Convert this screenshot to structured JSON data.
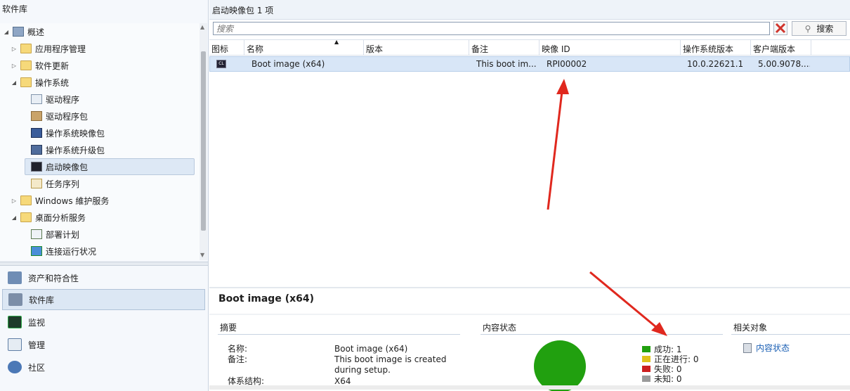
{
  "left_pane": {
    "title": "软件库",
    "tree": [
      {
        "label": "概述"
      },
      {
        "label": "应用程序管理"
      },
      {
        "label": "软件更新"
      },
      {
        "label": "操作系统"
      },
      {
        "label": "驱动程序"
      },
      {
        "label": "驱动程序包"
      },
      {
        "label": "操作系统映像包"
      },
      {
        "label": "操作系统升级包"
      },
      {
        "label": "启动映像包"
      },
      {
        "label": "任务序列"
      },
      {
        "label": "Windows 維护服务"
      },
      {
        "label": "桌面分析服务"
      },
      {
        "label": "部署计划"
      },
      {
        "label": "连接运行状况"
      }
    ],
    "workspaces": [
      {
        "label": "资产和符合性"
      },
      {
        "label": "软件库"
      },
      {
        "label": "监视"
      },
      {
        "label": "管理"
      },
      {
        "label": "社区"
      }
    ]
  },
  "content": {
    "header": "启动映像包 1 项",
    "search_placeholder": "搜索",
    "search_button": "搜索",
    "columns": [
      "图标",
      "名称",
      "版本",
      "备注",
      "映像 ID",
      "操作系统版本",
      "客户端版本"
    ],
    "rows": [
      {
        "name": "Boot image (x64)",
        "version": "",
        "comment": "This boot im...",
        "image_id": "RPI00002",
        "os_version": "10.0.22621.1",
        "client_version": "5.00.9078...."
      }
    ]
  },
  "details": {
    "title": "Boot image (x64)",
    "summary_title": "摘要",
    "content_status_title": "内容状态",
    "related_title": "相关对象",
    "summary": {
      "name_label": "名称:",
      "name_value": "Boot image (x64)",
      "comment_label": "备注:",
      "comment_value_1": "This boot image is created",
      "comment_value_2": "during setup.",
      "arch_label": "体系结构:",
      "arch_value": "X64"
    },
    "legend": [
      {
        "label": "成功: 1",
        "color": "#21a00f"
      },
      {
        "label": "正在进行: 0",
        "color": "#e0c21c"
      },
      {
        "label": "失败: 0",
        "color": "#cc1f1f"
      },
      {
        "label": "未知: 0",
        "color": "#9a9a9a"
      }
    ],
    "related_link": "内容状态"
  }
}
